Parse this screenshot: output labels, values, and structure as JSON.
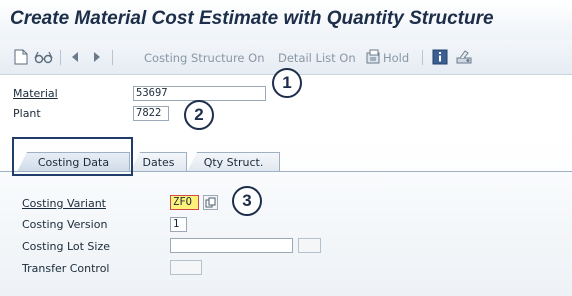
{
  "window": {
    "title": "Create Material Cost Estimate with Quantity Structure"
  },
  "toolbar": {
    "costing_structure_label": "Costing Structure On",
    "detail_list_label": "Detail List On",
    "hold_label": "Hold"
  },
  "header_fields": {
    "material_label": "Material",
    "material_value": "53697",
    "plant_label": "Plant",
    "plant_value": "7822"
  },
  "tabs": [
    {
      "label": "Costing Data",
      "active": true
    },
    {
      "label": "Dates",
      "active": false
    },
    {
      "label": "Qty Struct.",
      "active": false
    }
  ],
  "costing_data": {
    "variant_label": "Costing Variant",
    "variant_value": "ZFO",
    "version_label": "Costing Version",
    "version_value": "1",
    "lot_size_label": "Costing Lot Size",
    "lot_size_value": "",
    "transfer_control_label": "Transfer Control",
    "transfer_control_value": ""
  },
  "callouts": [
    "1",
    "2",
    "3"
  ],
  "icons": [
    "new-document-icon",
    "glasses-icon",
    "arrow-left-icon",
    "arrow-right-icon",
    "hold-icon",
    "info-icon",
    "settings-icon",
    "value-help-icon"
  ],
  "colors": {
    "title": "#1d2e4a",
    "highlight_border": "#1f3d68",
    "required_marker": "#d14a4a",
    "field_highlight": "#fff27a"
  }
}
